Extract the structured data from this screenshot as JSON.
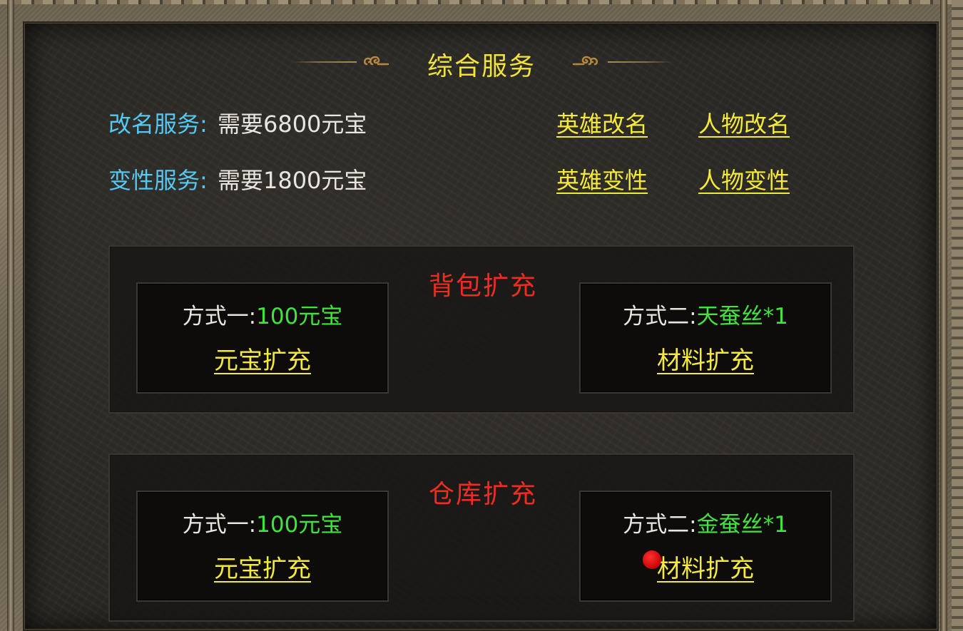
{
  "title": "综合服务",
  "services": [
    {
      "label": "改名服务",
      "colon": ":",
      "cost": "需要6800元宝",
      "links": [
        "英雄改名",
        "人物改名"
      ]
    },
    {
      "label": "变性服务",
      "colon": ":",
      "cost": "需要1800元宝",
      "links": [
        "英雄变性",
        "人物变性"
      ]
    }
  ],
  "bag_expand": {
    "title": "背包扩充",
    "option1": {
      "prefix": "方式一:",
      "cost": "100元宝",
      "action": "元宝扩充"
    },
    "option2": {
      "prefix": "方式二:",
      "cost": "天蚕丝*1",
      "action": "材料扩充"
    }
  },
  "warehouse_expand": {
    "title": "仓库扩充",
    "option1": {
      "prefix": "方式一:",
      "cost": "100元宝",
      "action": "元宝扩充"
    },
    "option2": {
      "prefix": "方式二:",
      "cost": "金蚕丝*1",
      "action": "材料扩充"
    }
  },
  "colors": {
    "title": "#f2e33a",
    "label": "#55c8f3",
    "link": "#f5e93a",
    "section_title": "#f02c22",
    "cost_green": "#3fe43c",
    "notification_dot": "#e01010"
  },
  "icons": {
    "title_ornament_left": "cloud-scroll-ornament-icon",
    "title_ornament_right": "cloud-scroll-ornament-icon",
    "notification": "red-dot-icon"
  }
}
